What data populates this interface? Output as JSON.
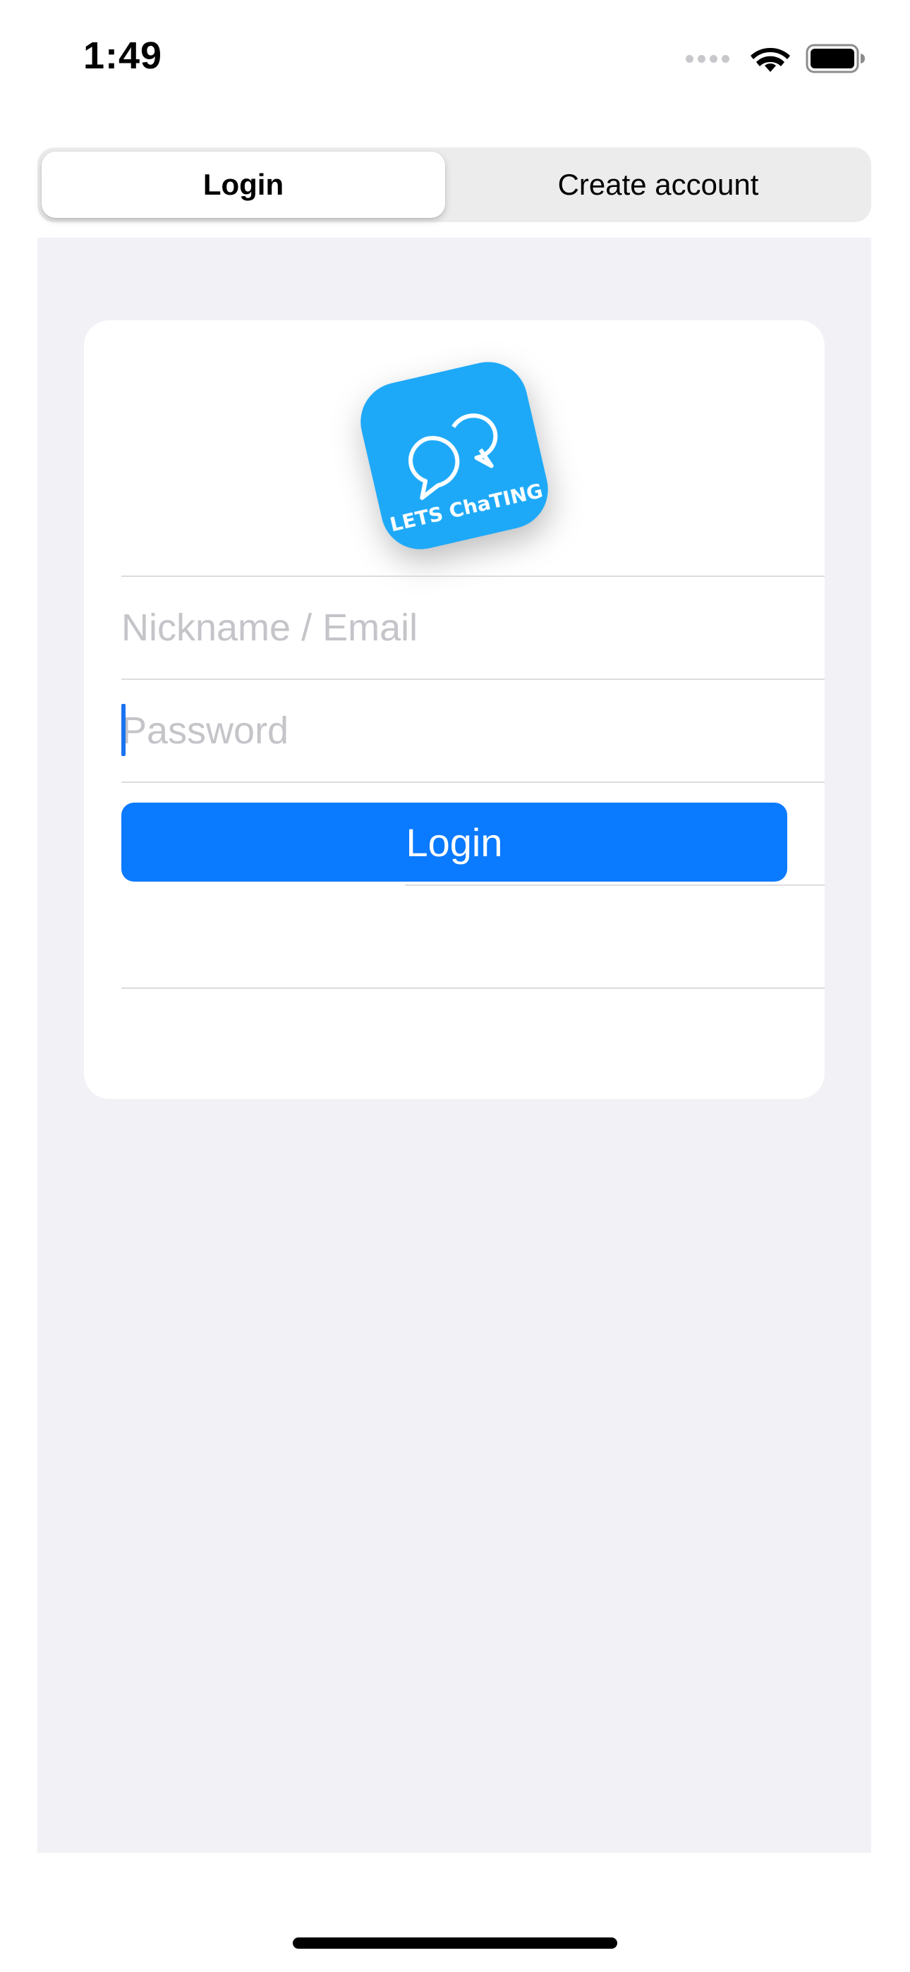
{
  "status_bar": {
    "time": "1:49",
    "signal_icon": "cellular-no-signal-icon",
    "wifi_icon": "wifi-icon",
    "battery_icon": "battery-full-icon"
  },
  "segmented_control": {
    "selected": "Login",
    "segments": [
      {
        "label": "Login"
      },
      {
        "label": "Create account"
      }
    ]
  },
  "logo": {
    "text": "LETS ChaTING",
    "icon": "chat-bubbles-icon",
    "color": "#1ea9f8"
  },
  "form": {
    "nickname_placeholder": "Nickname / Email",
    "nickname_value": "",
    "password_placeholder": "Password",
    "password_value": "",
    "login_button_label": "Login"
  },
  "colors": {
    "accent": "#0a7aff",
    "background": "#f1f1f6",
    "placeholder": "#c4c4c9"
  }
}
